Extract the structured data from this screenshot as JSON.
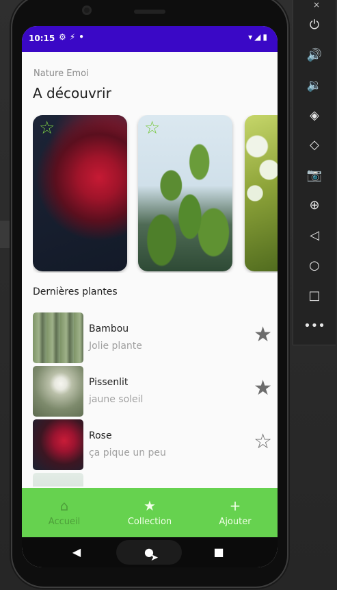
{
  "status_bar": {
    "time": "10:15",
    "left_icons": [
      "gear-icon",
      "signal-wifi-x-icon",
      "dot-icon"
    ],
    "right_icons": [
      "wifi-icon",
      "cell-icon",
      "battery-icon"
    ]
  },
  "header": {
    "subtitle": "Nature Emoi",
    "title": "A découvrir"
  },
  "featured": [
    {
      "name": "rose-card",
      "favorited": false
    },
    {
      "name": "cactus-card",
      "favorited": false
    },
    {
      "name": "lily-card",
      "favorited": false
    }
  ],
  "list": {
    "title": "Dernières plantes",
    "items": [
      {
        "name": "Bambou",
        "description": "Jolie plante",
        "favorited": true
      },
      {
        "name": "Pissenlit",
        "description": "jaune soleil",
        "favorited": true
      },
      {
        "name": "Rose",
        "description": "ça pique un peu",
        "favorited": false
      }
    ]
  },
  "bottom_nav": {
    "items": [
      {
        "label": "Accueil",
        "icon": "home-icon",
        "active": false
      },
      {
        "label": "Collection",
        "icon": "star-icon",
        "active": true
      },
      {
        "label": "Ajouter",
        "icon": "plus-icon",
        "active": false
      }
    ]
  },
  "system_nav": [
    "back-icon",
    "home-icon",
    "overview-icon"
  ],
  "emulator_toolbar": {
    "close": "×",
    "buttons": [
      "power-icon",
      "volume-up-icon",
      "volume-down-icon",
      "rotate-left-icon",
      "rotate-right-icon",
      "camera-icon",
      "zoom-icon",
      "back-icon",
      "home-icon",
      "overview-icon",
      "more-icon"
    ]
  },
  "colors": {
    "status_bar": "#3a08c6",
    "nav_bar": "#66d24f",
    "nav_inactive": "#4c9d39",
    "nav_active": "#f2ffe9",
    "card_star": "#7ac943"
  }
}
